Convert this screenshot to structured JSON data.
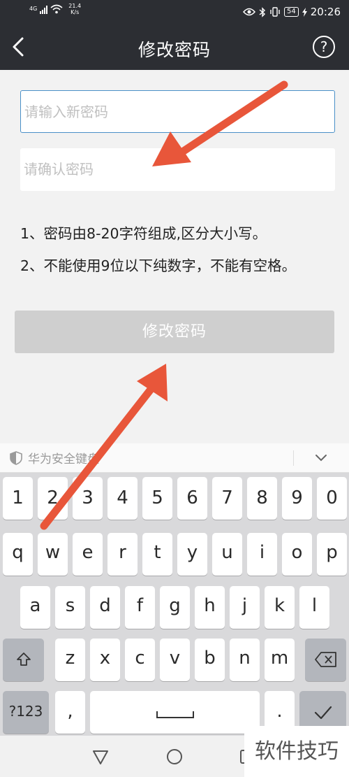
{
  "status_bar": {
    "network_type": "4G",
    "speed_value": "21.4",
    "speed_unit": "K/s",
    "battery": "54",
    "time": "20:26"
  },
  "header": {
    "title": "修改密码"
  },
  "form": {
    "new_password_placeholder": "请输入新密码",
    "confirm_password_placeholder": "请确认密码",
    "rule_1": "1、密码由8-20字符组成,区分大小写。",
    "rule_2": "2、不能使用9位以下纯数字，不能有空格。",
    "submit_label": "修改密码"
  },
  "keyboard": {
    "brand": "华为安全键盘",
    "number_row": [
      "1",
      "2",
      "3",
      "4",
      "5",
      "6",
      "7",
      "8",
      "9",
      "0"
    ],
    "row1": [
      "q",
      "w",
      "e",
      "r",
      "t",
      "y",
      "u",
      "i",
      "o",
      "p"
    ],
    "row2": [
      "a",
      "s",
      "d",
      "f",
      "g",
      "h",
      "j",
      "k",
      "l"
    ],
    "row3": [
      "z",
      "x",
      "c",
      "v",
      "b",
      "n",
      "m"
    ],
    "mode_label": "?123",
    "comma": ",",
    "period": "."
  },
  "watermark": {
    "text": "软件技巧"
  },
  "colors": {
    "header_bg": "#2c2e33",
    "focus_border": "#4a90c8",
    "annotation_arrow": "#e8563a"
  }
}
